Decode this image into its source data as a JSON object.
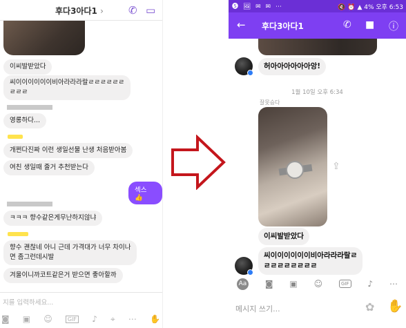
{
  "left": {
    "header": {
      "name": "후다3아다1",
      "chevron": "›"
    },
    "messages": [
      "이씨발받았다",
      "씨이이이이이이비아라라라랄ㄹㄹㄹㄹㄹㄹ\nㄹㄹㄹ",
      "영롱하다...",
      "개쩐다진짜 이런 생일선물 난생 처음받아봄",
      "여친 생일때 줄거 추천받는다",
      "ㅋㅋㅋ 향수같은게무난하지않냐",
      "향수 괜찮네 아니 근데 가격대가 너무 차이나\n면 좀그런데시발",
      "겨울이니까코트같은거 받으면 좋아할까"
    ],
    "sent_message": "섹스 👍",
    "composer_placeholder": "지를 입력하세요..."
  },
  "right": {
    "status": {
      "left_icons": "🅢 🖼 ✉ ✉ ⋯",
      "right_text": "🔇 ⏰ ▲ 4% 오후 6:53"
    },
    "appbar": {
      "title": "후다3아다1"
    },
    "messages": {
      "m1": "허아아아아아아앙!",
      "timestamp": "1월 10일 오후 6:34",
      "sender_label": "잘못승다",
      "m2": "이씨발받았다",
      "m3": "씨이이이이이이비아라라라랄ㄹ\nㄹㄹㄹㄹㄹㄹㄹㄹ"
    },
    "composer_placeholder": "메시지 쓰기..."
  },
  "colors": {
    "brand_purple": "#7e3ff2",
    "arrow_red": "#c4161c"
  }
}
